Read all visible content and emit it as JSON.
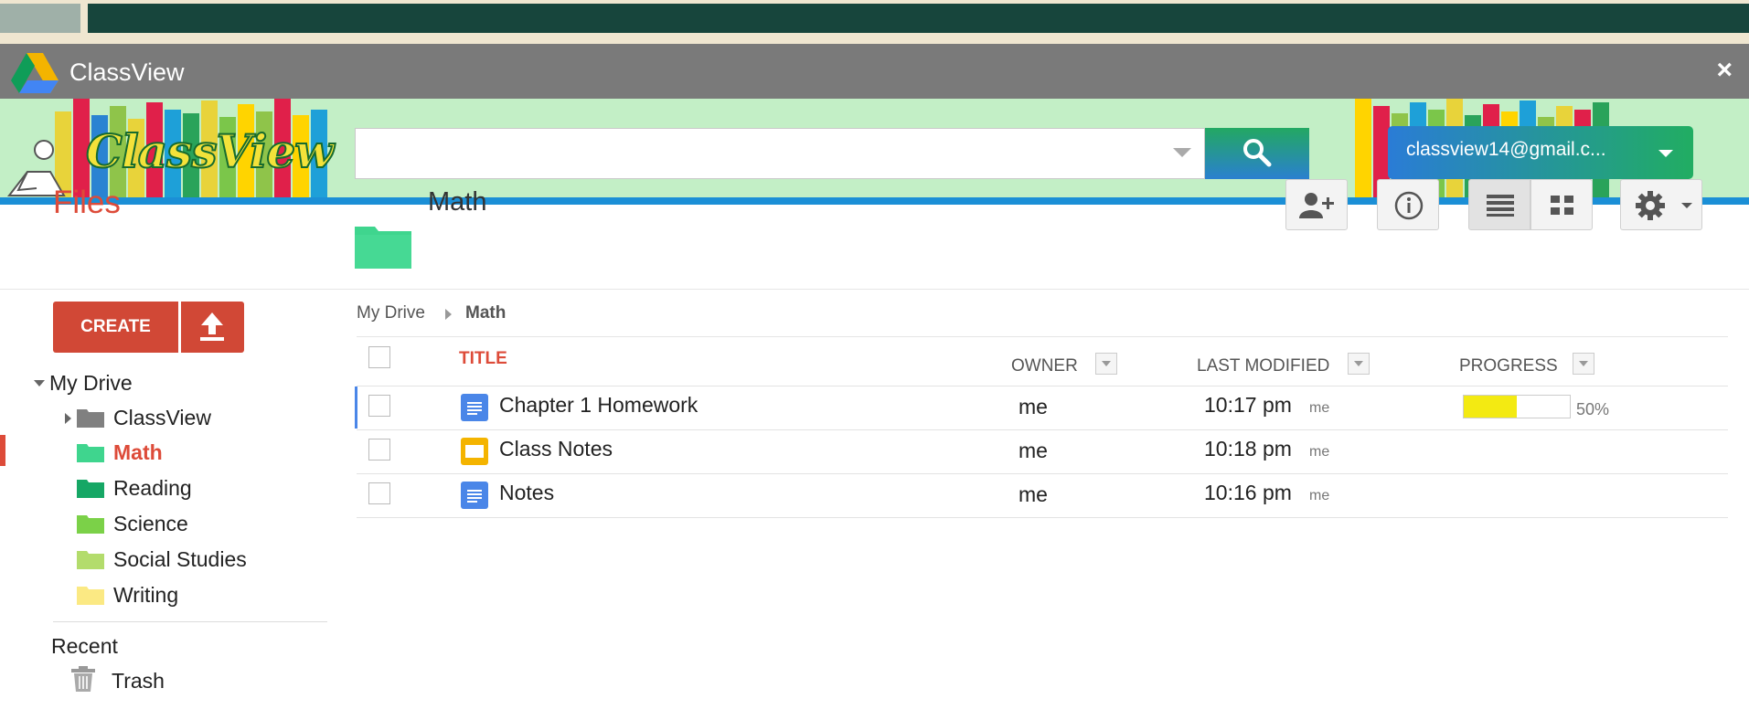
{
  "window": {
    "title": "ClassView",
    "close_glyph": "×"
  },
  "banner": {
    "brand": "ClassView",
    "search": {
      "value": "",
      "placeholder": ""
    },
    "account": {
      "label": "classview14@gmail.c..."
    }
  },
  "sidebar": {
    "heading": "Files",
    "create_label": "CREATE",
    "tree": {
      "root": "My Drive",
      "folders": [
        {
          "label": "ClassView",
          "color": "#808080"
        },
        {
          "label": "Math",
          "color": "#3fd58e",
          "selected": true
        },
        {
          "label": "Reading",
          "color": "#16a765"
        },
        {
          "label": "Science",
          "color": "#7bd148"
        },
        {
          "label": "Social Studies",
          "color": "#b3dc6c"
        },
        {
          "label": "Writing",
          "color": "#fbe983"
        }
      ]
    },
    "recent": "Recent",
    "trash": "Trash"
  },
  "content": {
    "folder_title": "Math",
    "breadcrumb": {
      "root": "My Drive",
      "current": "Math"
    },
    "columns": {
      "title": "TITLE",
      "owner": "OWNER",
      "last_modified": "LAST MODIFIED",
      "progress": "PROGRESS"
    },
    "rows": [
      {
        "title": "Chapter 1 Homework",
        "type": "doc",
        "owner": "me",
        "time": "10:17 pm",
        "by": "me",
        "progress": 0.5,
        "progress_label": "50%"
      },
      {
        "title": "Class Notes",
        "type": "slides",
        "owner": "me",
        "time": "10:18 pm",
        "by": "me"
      },
      {
        "title": "Notes",
        "type": "doc",
        "owner": "me",
        "time": "10:16 pm",
        "by": "me"
      }
    ]
  },
  "colors": {
    "accent_red": "#dd4b39",
    "doc_blue": "#4a86e8",
    "slides_yellow": "#f4b400",
    "progress_fill": "#f3ea12"
  },
  "icons": [
    "drive-logo-icon",
    "close-icon",
    "search-icon",
    "dropdown-caret-icon",
    "upload-icon",
    "add-person-icon",
    "info-icon",
    "list-view-icon",
    "grid-view-icon",
    "gear-icon",
    "folder-icon",
    "trash-icon",
    "doc-icon",
    "slides-icon"
  ]
}
